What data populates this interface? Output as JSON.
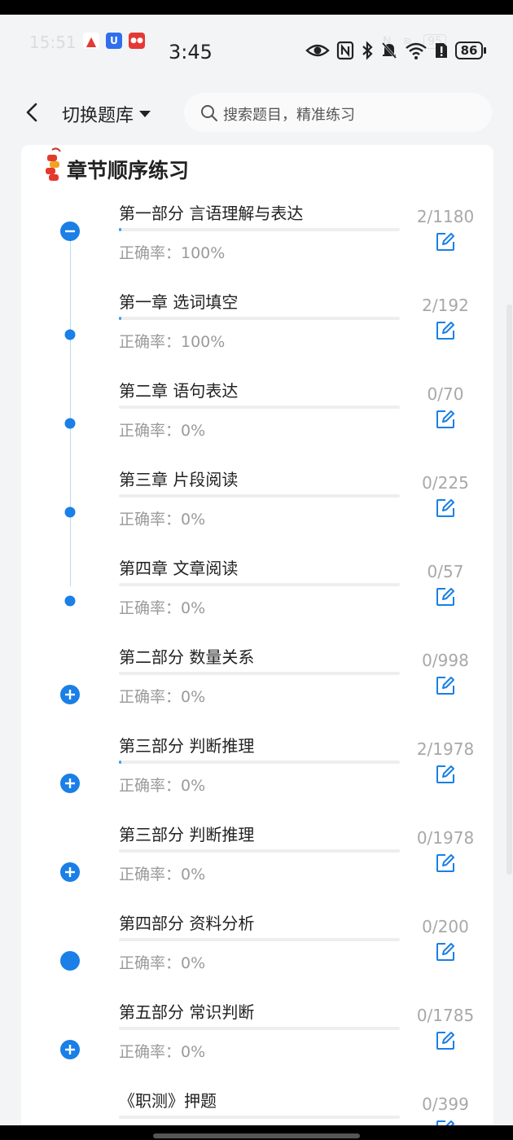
{
  "ghost_status": {
    "time": "15:51",
    "battery": "95"
  },
  "status_bar": {
    "time": "3:45",
    "battery": "86"
  },
  "header": {
    "switch_label": "切换题库",
    "search_placeholder": "搜索题目，精准练习"
  },
  "section": {
    "title": "章节顺序练习"
  },
  "colors": {
    "accent": "#1a7fe6",
    "progress": "#3aa0e8",
    "muted": "#9a9a9a"
  },
  "rows": [
    {
      "title": "第一部分 言语理解与表达",
      "accuracy": "正确率：100%",
      "count": "2/1180",
      "node": "minus-icon",
      "progress": 0.002
    },
    {
      "title": "第一章 选词填空",
      "accuracy": "正确率：100%",
      "count": "2/192",
      "node": "dot-icon",
      "progress": 0.01
    },
    {
      "title": "第二章 语句表达",
      "accuracy": "正确率：0%",
      "count": "0/70",
      "node": "dot-icon",
      "progress": 0
    },
    {
      "title": "第三章 片段阅读",
      "accuracy": "正确率：0%",
      "count": "0/225",
      "node": "dot-icon",
      "progress": 0
    },
    {
      "title": "第四章 文章阅读",
      "accuracy": "正确率：0%",
      "count": "0/57",
      "node": "dot-icon",
      "progress": 0
    },
    {
      "title": "第二部分 数量关系",
      "accuracy": "正确率：0%",
      "count": "0/998",
      "node": "plus-icon",
      "progress": 0
    },
    {
      "title": "第三部分 判断推理",
      "accuracy": "正确率：0%",
      "count": "2/1978",
      "node": "plus-icon",
      "progress": 0.001
    },
    {
      "title": "第三部分 判断推理",
      "accuracy": "正确率：0%",
      "count": "0/1978",
      "node": "plus-icon",
      "progress": 0
    },
    {
      "title": "第四部分 资料分析",
      "accuracy": "正确率：0%",
      "count": "0/200",
      "node": "filled-circle-icon",
      "progress": 0
    },
    {
      "title": "第五部分 常识判断",
      "accuracy": "正确率：0%",
      "count": "0/1785",
      "node": "plus-icon",
      "progress": 0
    },
    {
      "title": "《职测》押题",
      "accuracy": "",
      "count": "0/399",
      "node": "plus-icon",
      "progress": 0
    }
  ]
}
